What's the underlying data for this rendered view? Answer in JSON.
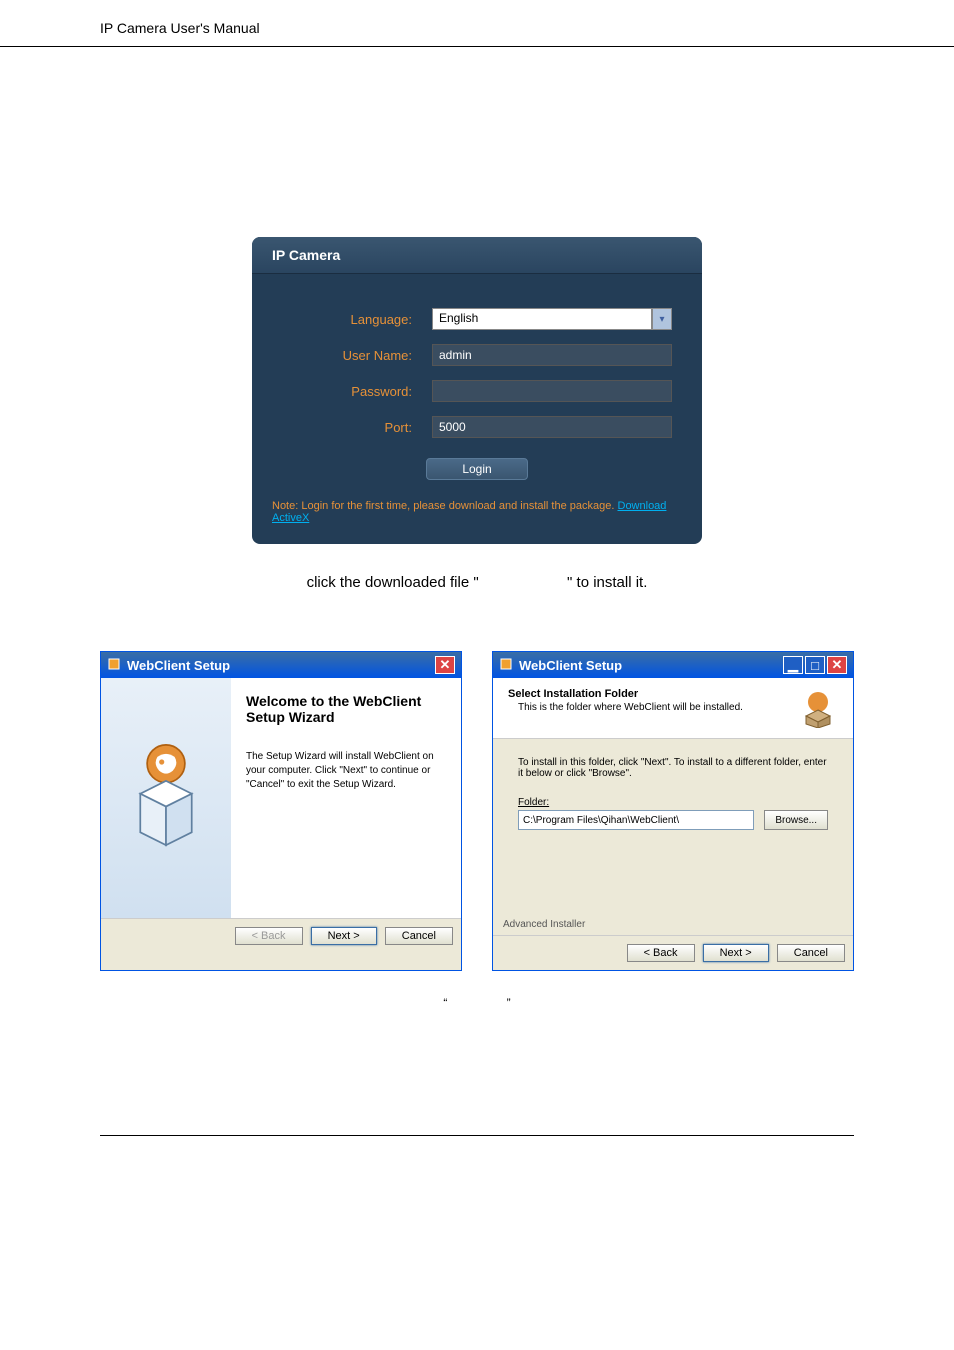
{
  "page_header": "IP Camera User's Manual",
  "login": {
    "title": "IP Camera",
    "labels": {
      "language": "Language:",
      "username": "User Name:",
      "password": "Password:",
      "port": "Port:"
    },
    "values": {
      "language": "English",
      "username": "admin",
      "password": "",
      "port": "5000"
    },
    "login_btn": "Login",
    "note_prefix": "Note: Login for the first time, please download and install the package.",
    "download_link": "Download ActiveX"
  },
  "instruction_prefix": "click the downloaded file \"",
  "instruction_suffix": "\" to install it.",
  "wizard_left": {
    "title": "WebClient Setup",
    "welcome_title": "Welcome to the WebClient Setup Wizard",
    "welcome_text": "The Setup Wizard will install WebClient on your computer. Click \"Next\" to continue or \"Cancel\" to exit the Setup Wizard.",
    "back": "< Back",
    "next": "Next >",
    "cancel": "Cancel"
  },
  "wizard_right": {
    "title": "WebClient Setup",
    "header_title": "Select Installation Folder",
    "header_sub": "This is the folder where WebClient will be installed.",
    "main_text": "To install in this folder, click \"Next\". To install to a different folder, enter it below or click \"Browse\".",
    "folder_label": "Folder:",
    "folder_value": "C:\\Program Files\\Qihan\\WebClient\\",
    "browse": "Browse...",
    "advanced": "Advanced Installer",
    "back": "< Back",
    "next": "Next >",
    "cancel": "Cancel"
  },
  "quote_left": "“",
  "quote_right": "”"
}
